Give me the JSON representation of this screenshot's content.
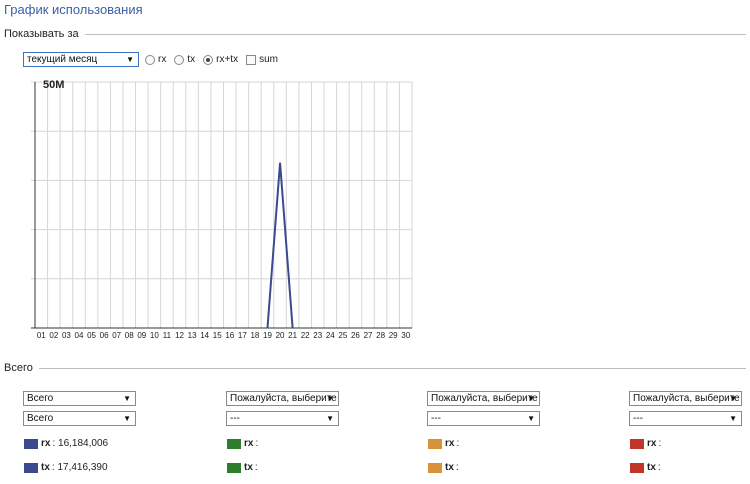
{
  "page": {
    "title": "График использования"
  },
  "period": {
    "legend": "Показывать за",
    "select_value": "текущий месяц",
    "options": [
      {
        "label": "rx",
        "checked": false
      },
      {
        "label": "tx",
        "checked": false
      },
      {
        "label": "rx+tx",
        "checked": true
      }
    ],
    "sum_label": "sum"
  },
  "chart_data": {
    "type": "line",
    "ymax_label": "50M",
    "ylim": [
      0,
      50000000
    ],
    "x": [
      "01",
      "02",
      "03",
      "04",
      "05",
      "06",
      "07",
      "08",
      "09",
      "10",
      "11",
      "12",
      "13",
      "14",
      "15",
      "16",
      "17",
      "18",
      "19",
      "20",
      "21",
      "22",
      "23",
      "24",
      "25",
      "26",
      "27",
      "28",
      "29",
      "30"
    ],
    "series": [
      {
        "color": "#3b4a8e",
        "points": [
          [
            19,
            0
          ],
          [
            20,
            33600000
          ],
          [
            21,
            0
          ]
        ]
      }
    ],
    "grid": true
  },
  "totals": {
    "legend": "Всего",
    "groups": [
      {
        "sel1": "Всего",
        "sel2": "Всего",
        "color": "#3b4a8e",
        "rx_label": "rx",
        "rx_value": "16,184,006",
        "tx_label": "tx",
        "tx_value": "17,416,390"
      },
      {
        "sel1": "Пожалуйста, выберите",
        "sel2": "---",
        "color": "#2e7d2a",
        "rx_label": "rx",
        "rx_value": "",
        "tx_label": "tx",
        "tx_value": ""
      },
      {
        "sel1": "Пожалуйста, выберите",
        "sel2": "---",
        "color": "#d8923a",
        "rx_label": "rx",
        "rx_value": "",
        "tx_label": "tx",
        "tx_value": ""
      },
      {
        "sel1": "Пожалуйста, выберите",
        "sel2": "---",
        "color": "#c0342a",
        "rx_label": "rx",
        "rx_value": "",
        "tx_label": "tx",
        "tx_value": ""
      }
    ]
  },
  "icons": {
    "dropdown": "triangle-down-icon"
  }
}
